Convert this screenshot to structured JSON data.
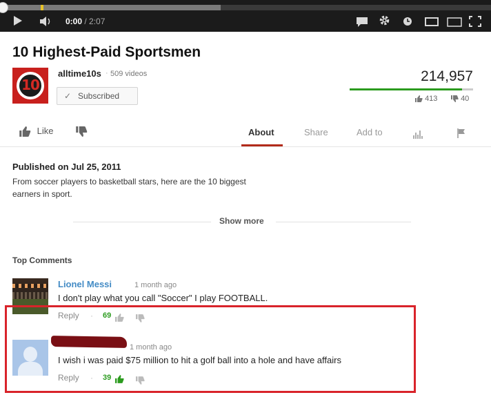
{
  "player": {
    "time_current": "0:00",
    "time_total": " / 2:07",
    "progress": 0.0,
    "buffered": 0.45,
    "icons": [
      "play-icon",
      "volume-icon",
      "captions-icon",
      "settings-icon",
      "watch-later-icon",
      "small-player-icon",
      "large-player-icon",
      "fullscreen-icon"
    ]
  },
  "video": {
    "title": "10 Highest-Paid Sportsmen",
    "channel_name": "alltime10s",
    "videos_count": "509 videos",
    "subscribe_label": "Subscribed",
    "views": "214,957",
    "likes": "413",
    "dislikes": "40",
    "like_ratio": 0.91,
    "logo_text": "10"
  },
  "actions": {
    "like_label": "Like",
    "tabs": {
      "about": "About",
      "share": "Share",
      "add_to": "Add to"
    }
  },
  "description": {
    "published": "Published on Jul 25, 2011",
    "line1": "From soccer players to basketball stars, here are the 10 biggest",
    "line2": "earners in sport.",
    "show_more": "Show more"
  },
  "comments": {
    "header": "Top Comments",
    "items": [
      {
        "author": "Lionel Messi",
        "time": "1 month ago",
        "text": "I don't play what you call \"Soccer\" I play FOOTBALL.",
        "reply_label": "Reply",
        "separator": "·",
        "likes": "69"
      },
      {
        "author": "",
        "time": "1 month ago",
        "text": "I wish i was paid $75 million to hit a golf ball into a hole and have affairs",
        "reply_label": "Reply",
        "separator": "·",
        "likes": "39"
      }
    ]
  },
  "colors": {
    "accent_red": "#b22a1a",
    "like_green": "#2b9b1e",
    "link_blue": "#438bc5",
    "highlight_red": "#d9232a"
  }
}
